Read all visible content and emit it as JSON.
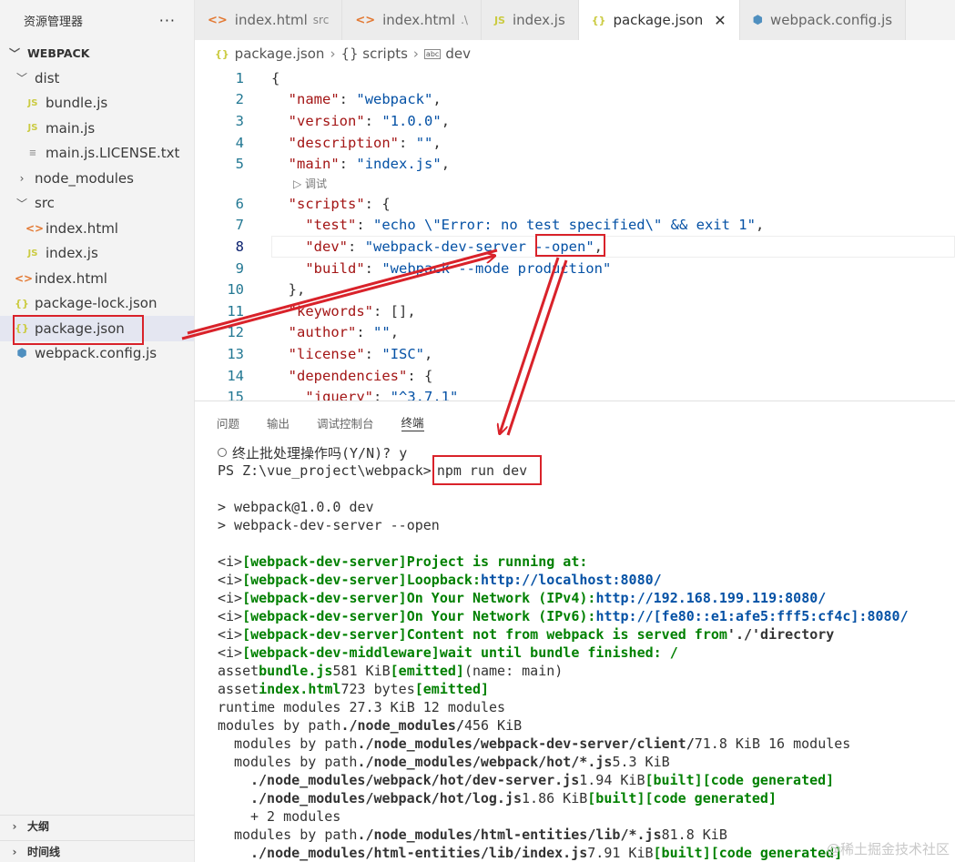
{
  "sidebar": {
    "title": "资源管理器",
    "more": "···",
    "root": "WEBPACK",
    "items": [
      {
        "label": "dist",
        "type": "folder",
        "open": true,
        "depth": 1
      },
      {
        "label": "bundle.js",
        "type": "js",
        "depth": 2
      },
      {
        "label": "main.js",
        "type": "js",
        "depth": 2
      },
      {
        "label": "main.js.LICENSE.txt",
        "type": "txt",
        "depth": 2
      },
      {
        "label": "node_modules",
        "type": "folder",
        "open": false,
        "depth": 1
      },
      {
        "label": "src",
        "type": "folder",
        "open": true,
        "depth": 1
      },
      {
        "label": "index.html",
        "type": "html",
        "depth": 2
      },
      {
        "label": "index.js",
        "type": "js",
        "depth": 2
      },
      {
        "label": "index.html",
        "type": "html",
        "depth": 1
      },
      {
        "label": "package-lock.json",
        "type": "json",
        "depth": 1
      },
      {
        "label": "package.json",
        "type": "json",
        "depth": 1,
        "selected": true
      },
      {
        "label": "webpack.config.js",
        "type": "cube",
        "depth": 1
      }
    ],
    "outline": "大纲",
    "timeline": "时间线"
  },
  "tabs": [
    {
      "label": "index.html",
      "sub": "src",
      "icon": "html-icon"
    },
    {
      "label": "index.html",
      "sub": ".\\",
      "icon": "html-icon"
    },
    {
      "label": "index.js",
      "sub": "",
      "icon": "js-icon"
    },
    {
      "label": "package.json",
      "sub": "",
      "icon": "json-icon",
      "active": true
    },
    {
      "label": "webpack.config.js",
      "sub": "",
      "icon": "cube-icon"
    }
  ],
  "icons": {
    "html": "<>",
    "js": "JS",
    "json": "{}",
    "cube": "⬢",
    "close": "✕"
  },
  "breadcrumb": {
    "file": "package.json",
    "scripts": "{} scripts",
    "dev": "dev"
  },
  "editor": {
    "codelens": "▷ 调试",
    "lines": [
      {
        "n": "1",
        "t": "{"
      },
      {
        "n": "2",
        "t": "  \"name\": \"webpack\","
      },
      {
        "n": "3",
        "t": "  \"version\": \"1.0.0\","
      },
      {
        "n": "4",
        "t": "  \"description\": \"\","
      },
      {
        "n": "5",
        "t": "  \"main\": \"index.js\","
      },
      {
        "n": "6",
        "t": "  \"scripts\": {"
      },
      {
        "n": "7",
        "t": "    \"test\": \"echo \\\"Error: no test specified\\\" && exit 1\","
      },
      {
        "n": "8",
        "t": "    \"dev\": \"webpack-dev-server --open\","
      },
      {
        "n": "9",
        "t": "    \"build\": \"webpack --mode production\""
      },
      {
        "n": "10",
        "t": "  },"
      },
      {
        "n": "11",
        "t": "  \"keywords\": [],"
      },
      {
        "n": "12",
        "t": "  \"author\": \"\","
      },
      {
        "n": "13",
        "t": "  \"license\": \"ISC\","
      },
      {
        "n": "14",
        "t": "  \"dependencies\": {"
      },
      {
        "n": "15",
        "t": "    \"jquery\": \"^3.7.1\""
      }
    ]
  },
  "panel": {
    "tabs": [
      "问题",
      "输出",
      "调试控制台",
      "终端"
    ],
    "active_tab": "终端"
  },
  "terminal": {
    "l1": "终止批处理操作吗(Y/N)? y",
    "l2_prompt": "PS Z:\\vue_project\\webpack>",
    "l2_cmd": "npm run dev",
    "l3": "> webpack@1.0.0 dev",
    "l4": "> webpack-dev-server --open",
    "info": "<i>",
    "wds": "[webpack-dev-server]",
    "wdm": "[webpack-dev-middleware]",
    "running": "Project is running at:",
    "loopback": "Loopback:",
    "loopback_url": "http://localhost:8080/",
    "ipv4": "On Your Network (IPv4):",
    "ipv4_url": "http://192.168.199.119:8080/",
    "ipv6": "On Your Network (IPv6):",
    "ipv6_url": "http://[fe80::e1:afe5:fff5:cf4c]:8080/",
    "content": "Content not from webpack is served from",
    "content_dir": "'./'",
    "directory": "directory",
    "wait": "wait until bundle finished: /",
    "asset": "asset",
    "bundle": "bundle.js",
    "bundle_size": "581 KiB",
    "emitted": "[emitted]",
    "name_main": "(name: main)",
    "index_html": "index.html",
    "index_size": "723 bytes",
    "runtime": "runtime modules 27.3 KiB 12 modules",
    "modules_by_path": "modules by path",
    "nm_path": "./node_modules/",
    "nm_size": "456 KiB",
    "client_path": "./node_modules/webpack-dev-server/client/",
    "client_size": "71.8 KiB 16 modules",
    "hot_path": "./node_modules/webpack/hot/*.js",
    "hot_size": "5.3 KiB",
    "devserver_path": "./node_modules/webpack/hot/dev-server.js",
    "devserver_size": "1.94 KiB",
    "built": "[built]",
    "code_generated": "[code generated]",
    "log_path": "./node_modules/webpack/hot/log.js",
    "log_size": "1.86 KiB",
    "plus": "+ 2 modules",
    "he_path": "./node_modules/html-entities/lib/*.js",
    "he_size": "81.8 KiB",
    "he_index": "./node_modules/html-entities/lib/index.js",
    "he_index_size": "7.91 KiB"
  },
  "watermark": "@稀土掘金技术社区",
  "colors": {
    "annotation": "#d9222a"
  }
}
